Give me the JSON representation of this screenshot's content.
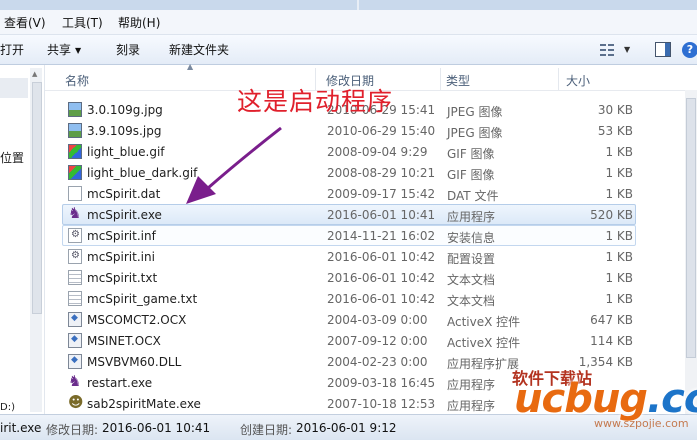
{
  "menu": {
    "view": "查看(V)",
    "tools": "工具(T)",
    "help": "帮助(H)"
  },
  "toolbar": {
    "open": "打开",
    "share": "共享",
    "burn": "刻录",
    "new_folder": "新建文件夹"
  },
  "navpane": {
    "location_fragment": "位置",
    "drive_fragment": "D:)"
  },
  "columns": {
    "name": "名称",
    "modified": "修改日期",
    "type": "类型",
    "size": "大小"
  },
  "files": [
    {
      "name": "3.0.109g.jpg",
      "modified": "2010-06-29 15:41",
      "type": "JPEG 图像",
      "size": "30 KB",
      "icon": "image-icon"
    },
    {
      "name": "3.9.109s.jpg",
      "modified": "2010-06-29 15:40",
      "type": "JPEG 图像",
      "size": "53 KB",
      "icon": "image-icon"
    },
    {
      "name": "light_blue.gif",
      "modified": "2008-09-04 9:29",
      "type": "GIF 图像",
      "size": "1 KB",
      "icon": "gif-icon"
    },
    {
      "name": "light_blue_dark.gif",
      "modified": "2008-08-29 10:21",
      "type": "GIF 图像",
      "size": "1 KB",
      "icon": "gif-icon"
    },
    {
      "name": "mcSpirit.dat",
      "modified": "2009-09-17 15:42",
      "type": "DAT 文件",
      "size": "1 KB",
      "icon": "blank-file-icon"
    },
    {
      "name": "mcSpirit.exe",
      "modified": "2016-06-01 10:41",
      "type": "应用程序",
      "size": "520 KB",
      "icon": "app-icon",
      "selected": true
    },
    {
      "name": "mcSpirit.inf",
      "modified": "2014-11-21 16:02",
      "type": "安装信息",
      "size": "1 KB",
      "icon": "settings-file-icon",
      "hover": true
    },
    {
      "name": "mcSpirit.ini",
      "modified": "2016-06-01 10:42",
      "type": "配置设置",
      "size": "1 KB",
      "icon": "settings-file-icon"
    },
    {
      "name": "mcSpirit.txt",
      "modified": "2016-06-01 10:42",
      "type": "文本文档",
      "size": "1 KB",
      "icon": "text-file-icon"
    },
    {
      "name": "mcSpirit_game.txt",
      "modified": "2016-06-01 10:42",
      "type": "文本文档",
      "size": "1 KB",
      "icon": "text-file-icon"
    },
    {
      "name": "MSCOMCT2.OCX",
      "modified": "2004-03-09 0:00",
      "type": "ActiveX 控件",
      "size": "647 KB",
      "icon": "activex-icon"
    },
    {
      "name": "MSINET.OCX",
      "modified": "2007-09-12 0:00",
      "type": "ActiveX 控件",
      "size": "114 KB",
      "icon": "activex-icon"
    },
    {
      "name": "MSVBVM60.DLL",
      "modified": "2004-02-23 0:00",
      "type": "应用程序扩展",
      "size": "1,354 KB",
      "icon": "activex-icon"
    },
    {
      "name": "restart.exe",
      "modified": "2009-03-18 16:45",
      "type": "应用程序",
      "size": "",
      "icon": "app-icon"
    },
    {
      "name": "sab2spiritMate.exe",
      "modified": "2007-10-18 12:53",
      "type": "应用程序",
      "size": "",
      "icon": "sab-app-icon"
    }
  ],
  "status": {
    "filename": "irit.exe",
    "modified_label": "修改日期:",
    "modified_value": "2016-06-01 10:41",
    "created_label": "创建日期:",
    "created_value": "2016-06-01 9:12"
  },
  "annotation": {
    "text": "这是启动程序",
    "color": "#e0202c"
  },
  "watermark": {
    "top": "软件下载站",
    "logo_main": "ucbug",
    "logo_suffix": ".cc",
    "url": "www.szpojie.com"
  },
  "colors": {
    "accent": "#3b6cb0",
    "selection": "#dce9f8",
    "annotation": "#e0202c",
    "arrow": "#7a1e8c"
  }
}
